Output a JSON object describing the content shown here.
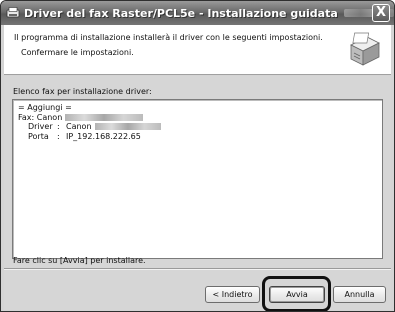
{
  "window": {
    "title": "Driver del fax Raster/PCL5e - Installazione guidata",
    "close_glyph": "X"
  },
  "header": {
    "line1": "Il programma di installazione installerà il driver con le seguenti impostazioni.",
    "line2": "Confermare le impostazioni."
  },
  "summary": {
    "label": "Elenco fax per installazione driver:",
    "add_line": "= Aggiungi =",
    "fax_prefix": "Fax: Canon",
    "driver_key": "Driver",
    "driver_prefix": "Canon",
    "port_key": "Porta",
    "port_value": "IP_192.168.222.65",
    "separator": ":"
  },
  "hint": "Fare clic su [Avvia] per installare.",
  "buttons": {
    "back": "< Indietro",
    "start": "Avvia",
    "cancel": "Annulla"
  }
}
